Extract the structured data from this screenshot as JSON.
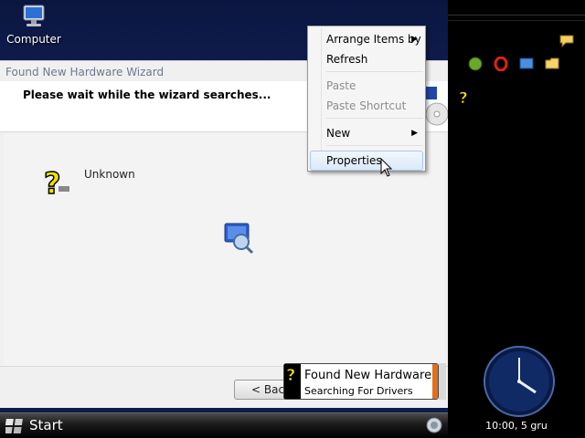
{
  "desktop": {
    "computer_label": "Computer"
  },
  "wizard": {
    "title": "Found New Hardware Wizard",
    "heading": "Please wait while the wizard searches...",
    "device_label": "Unknown",
    "back_label": "< Back"
  },
  "context_menu": {
    "items": [
      {
        "label": "Arrange Items by",
        "submenu": true,
        "enabled": true
      },
      {
        "label": "Refresh",
        "enabled": true
      },
      {
        "label": "Paste",
        "enabled": false
      },
      {
        "label": "Paste Shortcut",
        "enabled": false
      },
      {
        "label": "New",
        "submenu": true,
        "enabled": true
      },
      {
        "label": "Properties",
        "enabled": true,
        "highlighted": true
      }
    ]
  },
  "notification": {
    "title": "Found New Hardware",
    "text": "Searching For Drivers",
    "icon": "question-mark-icon"
  },
  "taskbar": {
    "start_label": "Start"
  },
  "sidebar": {
    "clock_text": "10:00, 5 gru",
    "quick_launch": [
      "green-orb-icon",
      "opera-icon",
      "desktop-icon",
      "folder-icon"
    ]
  },
  "colors": {
    "desktop_bg": "#0f1c52",
    "accent_orange": "#e07020",
    "menu_highlight": "#dbe9f8"
  }
}
